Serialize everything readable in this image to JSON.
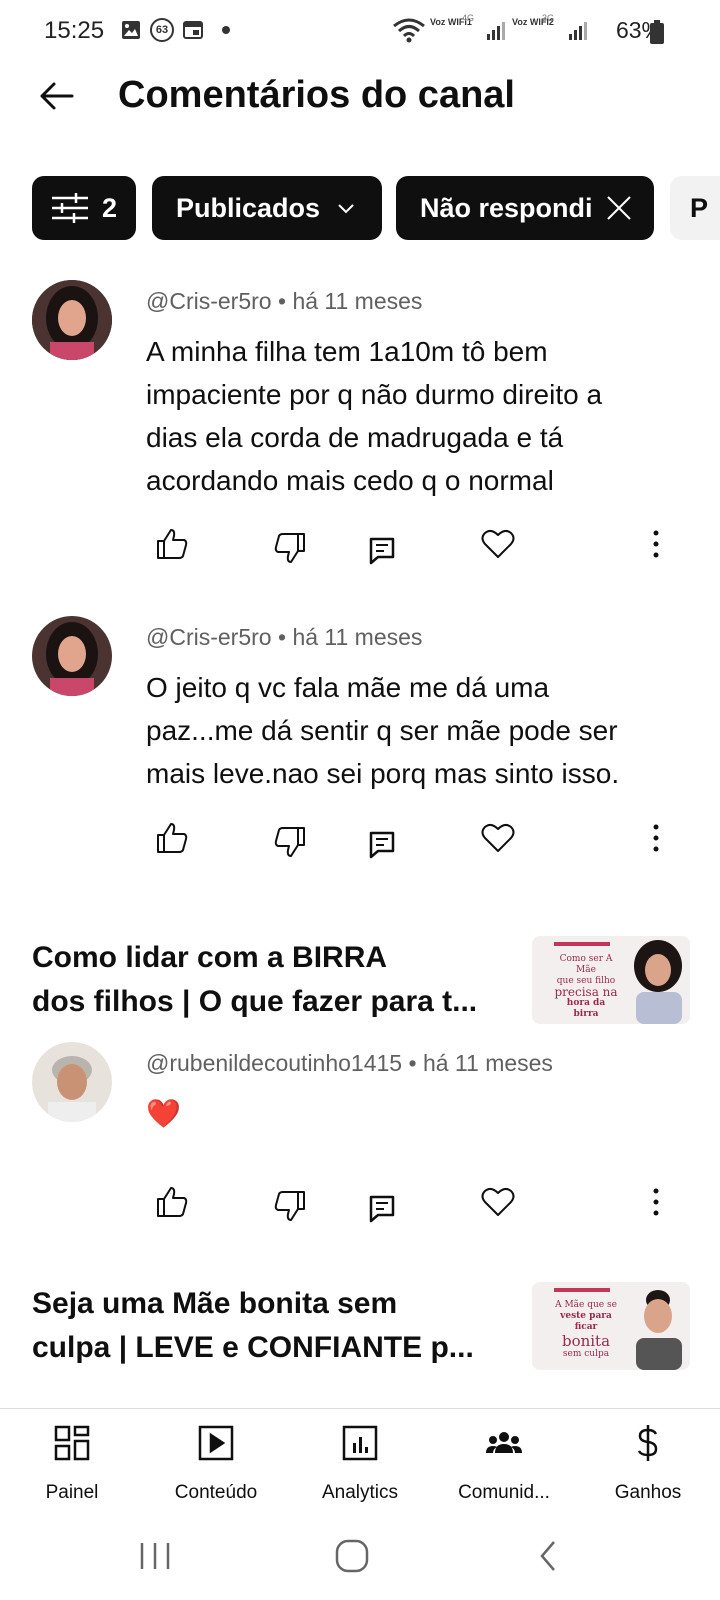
{
  "status_bar": {
    "time": "15:25",
    "notification_count": "63",
    "carrier1": "Voz WIFI1",
    "carrier1_net": "4G",
    "carrier2": "Voz WIFI2",
    "carrier2_net": "3G",
    "battery": "63%"
  },
  "header": {
    "title": "Comentários do canal"
  },
  "filters": {
    "filter_count": "2",
    "chips": [
      {
        "label": "Publicados"
      },
      {
        "label": "Não respondi"
      },
      {
        "label": "P"
      }
    ]
  },
  "comments": [
    {
      "author": "@Cris-er5ro",
      "time": "há 11 meses",
      "lines": [
        "A minha filha tem 1a10m tô bem",
        "impaciente por q não durmo direito a",
        "dias ela corda de madrugada e tá",
        "acordando mais cedo q o normal"
      ]
    },
    {
      "author": "@Cris-er5ro",
      "time": "há 11 meses",
      "lines": [
        "O jeito q vc fala mãe me dá uma",
        "paz...me dá sentir q ser mãe pode ser",
        "mais leve.nao sei porq mas sinto isso."
      ]
    },
    {
      "author": "@rubenildecoutinho1415",
      "time": "há 11 meses",
      "lines": [
        "❤️"
      ]
    }
  ],
  "separator": "•",
  "videos": [
    {
      "title_lines": [
        "Como lidar com a BIRRA",
        "dos filhos | O que fazer para t..."
      ],
      "thumb_text": [
        "Como ser A Mãe",
        "que seu filho",
        "precisa na",
        "hora da birra"
      ]
    },
    {
      "title_lines": [
        "Seja uma Mãe bonita sem",
        "culpa | LEVE e CONFIANTE p..."
      ],
      "thumb_text": [
        "A Mãe que se",
        "veste para ficar",
        "bonita",
        "sem culpa"
      ]
    }
  ],
  "bottom_nav": [
    {
      "label": "Painel",
      "icon": "dashboard-icon"
    },
    {
      "label": "Conteúdo",
      "icon": "content-icon"
    },
    {
      "label": "Analytics",
      "icon": "analytics-icon"
    },
    {
      "label": "Comunid...",
      "icon": "community-icon"
    },
    {
      "label": "Ganhos",
      "icon": "earnings-icon"
    }
  ],
  "colors": {
    "chip_bg": "#0f0f0f",
    "meta_text": "#606060",
    "heart": "#e0101d"
  }
}
